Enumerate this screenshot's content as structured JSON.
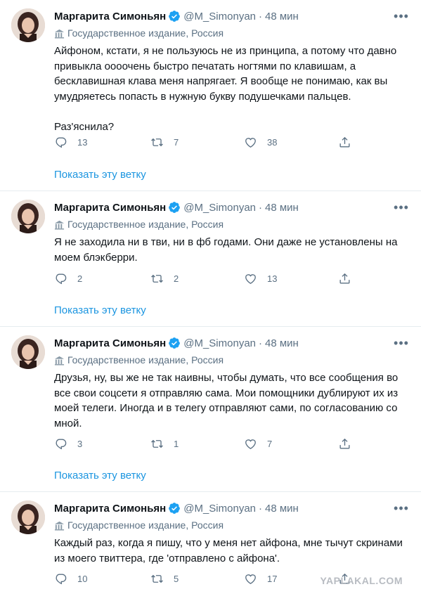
{
  "tweets": [
    {
      "name": "Маргарита Симоньян",
      "handle": "@M_Simonyan",
      "dot": "·",
      "time": "48 мин",
      "label": "Государственное издание, Россия",
      "text": "Айфоном, кстати, я не пользуюсь не из принципа, а потому что давно привыкла оооочень быстро печатать ногтями по клавишам, а бесклавишная клава меня напрягает. Я вообще не понимаю, как вы умудряетесь попасть в нужную букву подушечками пальцев.\n\nРаз'яснила?",
      "replies": "13",
      "retweets": "7",
      "likes": "38",
      "show_thread": "Показать эту ветку"
    },
    {
      "name": "Маргарита Симоньян",
      "handle": "@M_Simonyan",
      "dot": "·",
      "time": "48 мин",
      "label": "Государственное издание, Россия",
      "text": "Я не заходила ни в тви, ни в фб годами. Они даже не установлены на моем блэкберри.",
      "replies": "2",
      "retweets": "2",
      "likes": "13",
      "show_thread": "Показать эту ветку"
    },
    {
      "name": "Маргарита Симоньян",
      "handle": "@M_Simonyan",
      "dot": "·",
      "time": "48 мин",
      "label": "Государственное издание, Россия",
      "text": "Друзья, ну, вы же не так наивны, чтобы думать, что все сообщения во все свои соцсети я отправляю сама. Мои помощники дублируют их из моей телеги. Иногда и в телегу отправляют сами, по согласованию со мной.",
      "replies": "3",
      "retweets": "1",
      "likes": "7",
      "show_thread": "Показать эту ветку"
    },
    {
      "name": "Маргарита Симоньян",
      "handle": "@M_Simonyan",
      "dot": "·",
      "time": "48 мин",
      "label": "Государственное издание, Россия",
      "text": "Каждый раз, когда я пишу, что у меня нет айфона, мне тычут скринами из моего твиттера, где 'отправлено с айфона'.",
      "replies": "10",
      "retweets": "5",
      "likes": "17"
    }
  ],
  "watermark": "YAPLAKAL.COM",
  "icons": {
    "verified": "verified-badge-icon",
    "label": "state-media-flag-icon",
    "reply": "reply-icon",
    "retweet": "retweet-icon",
    "like": "heart-icon",
    "share": "share-icon",
    "more": "more-icon"
  },
  "colors": {
    "accent": "#1b95e0",
    "verified": "#1da1f2",
    "secondary_text": "#5b7083",
    "divider": "#e6ecf0"
  }
}
